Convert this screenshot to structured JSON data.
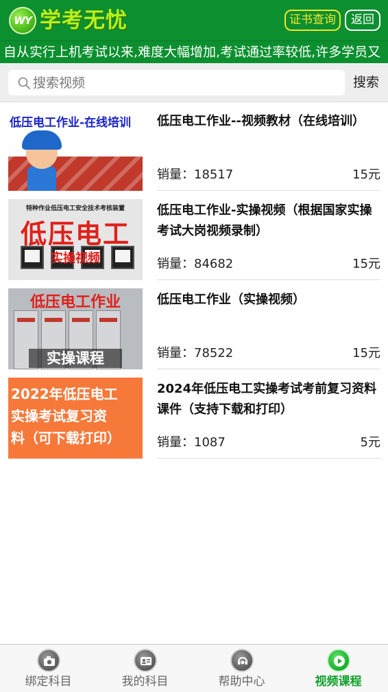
{
  "header": {
    "logo_mark": "WY",
    "logo_text": "学考无忧",
    "cert_button": "证书查询",
    "back_button": "返回",
    "background_color": "#0c8f2f"
  },
  "marquee": {
    "text": "自从实行上机考试以来,难度大幅增加,考试通过率较低,许多学员又"
  },
  "search": {
    "placeholder": "搜索视频",
    "value": "",
    "button_label": "搜索"
  },
  "courses": [
    {
      "title": "低压电工作业--视频教材（在线培训）",
      "sales_label": "销量：",
      "sales": "18517",
      "price": "15元",
      "thumb_text": "低压电工作业-在线培训"
    },
    {
      "title": "低压电工作业-实操视频（根据国家实操考试大岗视频录制）",
      "sales_label": "销量：",
      "sales": "84682",
      "price": "15元",
      "thumb_small": "特种作业低压电工安全技术考核装置",
      "thumb_big": "低压电工",
      "thumb_sub": "实操视频"
    },
    {
      "title": "低压电工作业（实操视频）",
      "sales_label": "销量：",
      "sales": "78522",
      "price": "15元",
      "thumb_top": "低压电工作业",
      "thumb_band": "实操课程"
    },
    {
      "title": "2024年低压电工实操考试考前复习资料课件（支持下载和打印）",
      "sales_label": "销量：",
      "sales": "1087",
      "price": "5元",
      "thumb_lines": [
        "2022年低压电工",
        "实操考试复习资",
        "料（可下载打印）"
      ]
    }
  ],
  "bottom_nav": {
    "items": [
      {
        "label": "绑定科目",
        "icon": "camera-icon",
        "active": false
      },
      {
        "label": "我的科目",
        "icon": "profile-card-icon",
        "active": false
      },
      {
        "label": "帮助中心",
        "icon": "headset-online-icon",
        "active": false
      },
      {
        "label": "视频课程",
        "icon": "play-icon",
        "active": true
      }
    ],
    "active_color": "#0fa12a"
  }
}
